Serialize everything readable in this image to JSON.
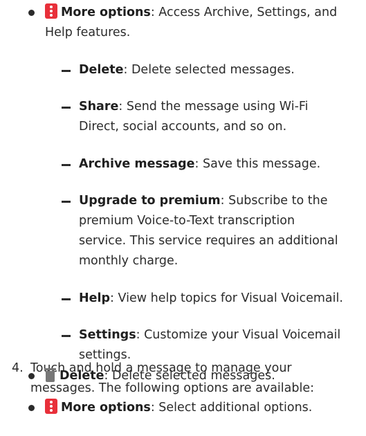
{
  "items": {
    "more_options_1": {
      "title": "More options",
      "desc_line1": ": Access Archive, Settings, and",
      "desc_line2": "Help features."
    },
    "delete": {
      "title": "Delete",
      "desc": ": Delete selected messages."
    },
    "share": {
      "title": "Share",
      "desc_line1": ": Send the message using Wi-Fi",
      "desc_line2": "Direct, social accounts, and so on."
    },
    "archive": {
      "title": "Archive message",
      "desc": ": Save this message."
    },
    "upgrade": {
      "title": "Upgrade to premium",
      "desc_line1": ": Subscribe to the",
      "desc_line2": "premium Voice-to-Text transcription",
      "desc_line3": "service. This service requires an additional",
      "desc_line4": "monthly charge."
    },
    "help": {
      "title": "Help",
      "desc": ": View help topics for Visual Voicemail."
    },
    "settings": {
      "title": "Settings",
      "desc_line1": ": Customize your Visual Voicemail",
      "desc_line2": "settings."
    }
  },
  "step4": {
    "number": "4.",
    "line1": "Touch and hold a message to manage your",
    "line2": "messages. The following options are available:"
  },
  "step4_items": {
    "delete": {
      "title": "Delete",
      "desc": ": Delete selected messages."
    },
    "more_options": {
      "title": "More options",
      "desc": ": Select additional options."
    }
  },
  "icons": {
    "more_options": "more-options-icon",
    "delete": "trash-icon"
  },
  "colors": {
    "more_options_icon": "#e8303a",
    "trash_icon": "#777777",
    "text": "#2b2b2b"
  }
}
